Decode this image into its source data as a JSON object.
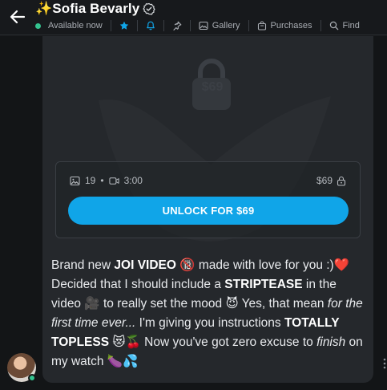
{
  "header": {
    "title": "✨Sofia Bevarly",
    "status": "Available now",
    "tabs": [
      "Gallery",
      "Purchases",
      "Find"
    ]
  },
  "post": {
    "price_watermark": "$69",
    "media_count": "19",
    "video_duration": "3:00",
    "price": "$69",
    "unlock_label": "UNLOCK FOR $69",
    "message": {
      "t1": "Brand new ",
      "b1": "JOI VIDEO",
      "t2": " 🔞 made with love for you :)❤️ Decided that I should include a ",
      "b2": "STRIPTEASE",
      "t3": " in the video 🎥 to really set the mood 😈 Yes, that mean ",
      "i1": "for the first time ever...",
      "t4": " I'm giving you instructions ",
      "b3": "TOTALLY TOPLESS",
      "t5": " 😻🍒 Now you've got zero excuse to ",
      "i2": "finish",
      "t6": " on my watch 🍆💦"
    }
  },
  "colors": {
    "accent": "#10a5e8",
    "online": "#34c38f",
    "background": "#17191c",
    "bubble": "#25282c"
  },
  "icons": [
    "back-arrow-icon",
    "verified-icon",
    "star-icon",
    "bell-icon",
    "pin-icon",
    "image-icon",
    "video-icon",
    "lock-icon",
    "dots-icon"
  ]
}
